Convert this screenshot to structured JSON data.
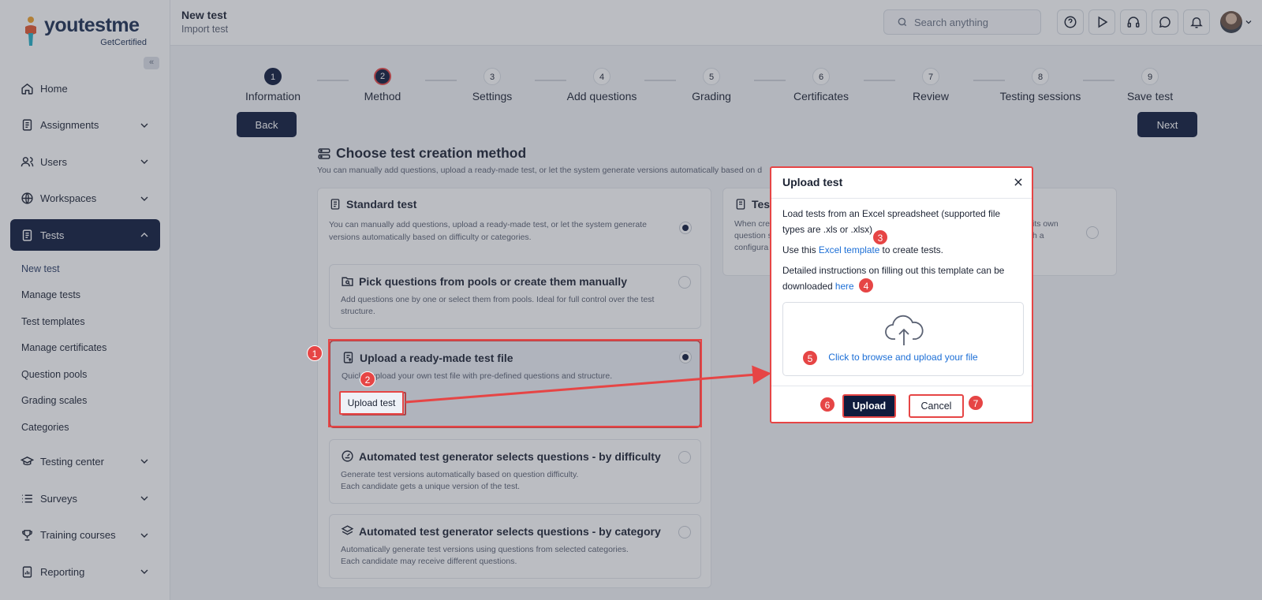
{
  "logo": {
    "main": "youtestme",
    "sub": "GetCertified"
  },
  "header": {
    "title": "New test",
    "subtitle": "Import test",
    "search_placeholder": "Search anything"
  },
  "sidebar": {
    "collapse": "«",
    "items": [
      {
        "label": "Home",
        "icon": "home-icon"
      },
      {
        "label": "Assignments",
        "icon": "document-icon"
      },
      {
        "label": "Users",
        "icon": "users-icon"
      },
      {
        "label": "Workspaces",
        "icon": "globe-icon"
      },
      {
        "label": "Tests",
        "icon": "test-icon"
      },
      {
        "label": "Testing center",
        "icon": "graduation-cap-icon"
      },
      {
        "label": "Surveys",
        "icon": "list-icon"
      },
      {
        "label": "Training courses",
        "icon": "trophy-icon"
      },
      {
        "label": "Reporting",
        "icon": "report-icon"
      }
    ],
    "tests_sub": [
      "New test",
      "Manage tests",
      "Test templates",
      "Manage certificates",
      "Question pools",
      "Grading scales",
      "Categories"
    ]
  },
  "stepper": {
    "steps": [
      {
        "num": "1",
        "label": "Information"
      },
      {
        "num": "2",
        "label": "Method"
      },
      {
        "num": "3",
        "label": "Settings"
      },
      {
        "num": "4",
        "label": "Add questions"
      },
      {
        "num": "5",
        "label": "Grading"
      },
      {
        "num": "6",
        "label": "Certificates"
      },
      {
        "num": "7",
        "label": "Review"
      },
      {
        "num": "8",
        "label": "Testing sessions"
      },
      {
        "num": "9",
        "label": "Save test"
      }
    ],
    "back": "Back",
    "next": "Next"
  },
  "main": {
    "title": "Choose test creation method",
    "desc": "You can manually add questions, upload a ready-made test, or let the system generate versions automatically based on d",
    "standard": {
      "title": "Standard test",
      "desc": "You can manually add questions, upload a ready-made test, or let the system generate versions automatically based on difficulty or categories."
    },
    "options": [
      {
        "title": "Pick questions from pools or create them manually",
        "desc": "Add questions one by one or select them from pools. Ideal for full control over the test structure."
      },
      {
        "title": "Upload a ready-made test file",
        "desc": "Quickly upload your own test file with pre-defined questions and structure.",
        "button": "Upload test"
      },
      {
        "title": "Automated test generator selects questions - by difficulty",
        "desc": "Generate test versions automatically based on question difficulty.\nEach candidate gets a unique version of the test."
      },
      {
        "title": "Automated test generator selects questions - by category",
        "desc": "Automatically generate test versions using questions from selected categories.\nEach candidate may receive different questions."
      }
    ],
    "right_card": {
      "title": "Tes",
      "desc_lines": [
        "When cre",
        "question s",
        "configura"
      ],
      "desc_right": [
        "its own",
        "h a"
      ]
    }
  },
  "modal": {
    "title": "Upload test",
    "p1": "Load tests from an Excel spreadsheet (supported file types are .xls or .xlsx)",
    "p2_before": "Use this ",
    "p2_link": "Excel template",
    "p2_after": " to create tests.",
    "p3_before": "Detailed instructions on filling out this template can be downloaded ",
    "p3_link": "here",
    "dropzone": "Click to browse and upload your file",
    "upload": "Upload",
    "cancel": "Cancel"
  },
  "badges": [
    "1",
    "2",
    "3",
    "4",
    "5",
    "6",
    "7"
  ],
  "colors": {
    "brand_dark": "#0f1b3d",
    "highlight": "#e64545",
    "link": "#1b6ed6"
  }
}
